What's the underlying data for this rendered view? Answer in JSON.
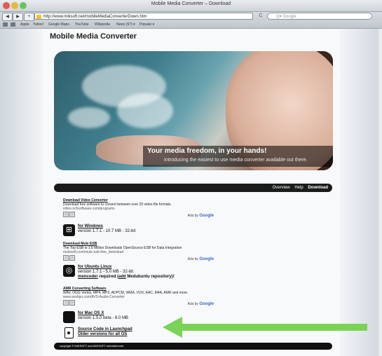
{
  "window": {
    "title": "Mobile Media Converter – Download"
  },
  "toolbar": {
    "back": "◀",
    "forward": "▶",
    "add": "+",
    "url": "http://www.miksoft.net/mobileMediaConverterDown.htm",
    "reload": "C",
    "search_placeholder": "Q▾ Google"
  },
  "bookmarks": [
    "Apple",
    "Yahoo!",
    "Google Maps",
    "YouTube",
    "Wikipedia",
    "News (57) ▾",
    "Popular ▾"
  ],
  "page": {
    "site_title": "Mobile Media Converter",
    "hero": {
      "headline": "Your media freedom, in your hands!",
      "subtitle": "Introducing the easiest to use media converter available out there."
    },
    "nav": {
      "items": [
        "Overview",
        "Help",
        "Download"
      ],
      "active": "Download"
    },
    "ads": [
      {
        "title": "Download Video Converter",
        "desc": "Download free software to convert between over 20 video file formats.",
        "url": "video.nchsoftware.com/programs"
      },
      {
        "title": "Download Mule ESB",
        "desc": "The Top ESB w 1.5 Million Downloads OpenSource ESB for Data Integration",
        "url": "mulesoft.com/mule-esb-free_download"
      },
      {
        "title": "AMR Converting Software",
        "desc": "WAV, OGG Vorbis, MP4, MP2, ADPCM, WMA, VOX, AAC, M4A, AMR and more.",
        "url": "www.avshpu.com/AVS-Audio-Converter"
      }
    ],
    "ads_by": "Ads by",
    "ads_brand": "Google",
    "downloads": {
      "windows": {
        "name": "for Windows",
        "version": "version 1.7.1 - 10.7 MB - 32-bit"
      },
      "ubuntu": {
        "name": "for Ubuntu Linux",
        "version": "version 1.7.1 - 5.0 MB - 32-bit",
        "note_pkg": "mencoder",
        "note_mid": " required (",
        "note_add": "add",
        "note_end": " Medubuntu repository)!"
      },
      "mac": {
        "name": "for Mac OS X",
        "version": "version 1.5.0 beta - 8.0 MB"
      }
    },
    "source": {
      "launchpad": "Source Code in Launchpad",
      "older": "Older versions for all OS"
    },
    "footer": "copyright © MIKSOFT and MIKSOFT entertainment"
  },
  "colors": {
    "arrow": "#7bd356",
    "nav_bg": "#1b1b1b"
  }
}
